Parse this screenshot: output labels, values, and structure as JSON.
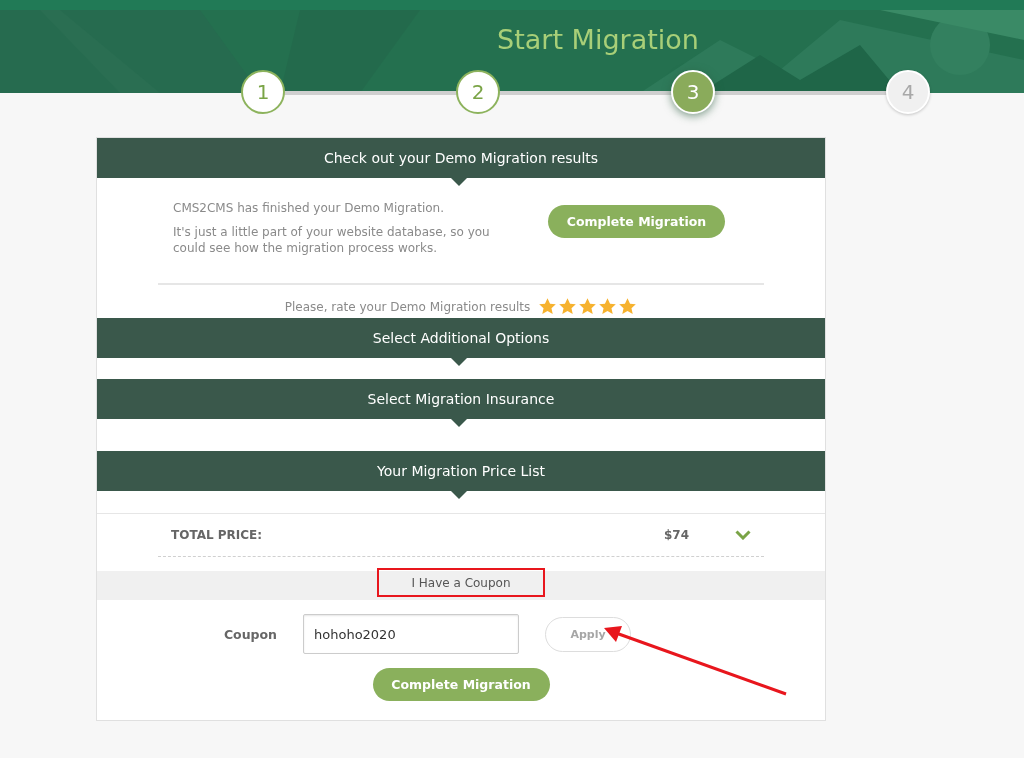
{
  "header": {
    "title": "Start Migration"
  },
  "steps": [
    {
      "label": "1",
      "done": true,
      "selected": false
    },
    {
      "label": "2",
      "done": true,
      "selected": false
    },
    {
      "label": "3",
      "done": false,
      "selected": true
    },
    {
      "label": "4",
      "done": false,
      "selected": false
    }
  ],
  "demo": {
    "heading": "Check out your Demo Migration results",
    "paragraphs": [
      "CMS2CMS has finished your Demo Migration.",
      "It's just a little part of your website database, so you could see how the migration process works."
    ],
    "button": "Complete Migration",
    "rating_label": "Please, rate your Demo Migration results",
    "stars": 5
  },
  "sections": [
    {
      "heading": "Select Additional Options"
    },
    {
      "heading": "Select Migration Insurance"
    }
  ],
  "price_list": {
    "heading": "Your Migration Price List",
    "total_label": "TOTAL PRICE:",
    "total_value": "$74"
  },
  "coupon": {
    "toggle": "I Have a Coupon",
    "label": "Coupon",
    "value": "hohoho2020",
    "apply": {
      "label": "Apply",
      "disabled": true
    },
    "button": "Complete Migration"
  }
}
